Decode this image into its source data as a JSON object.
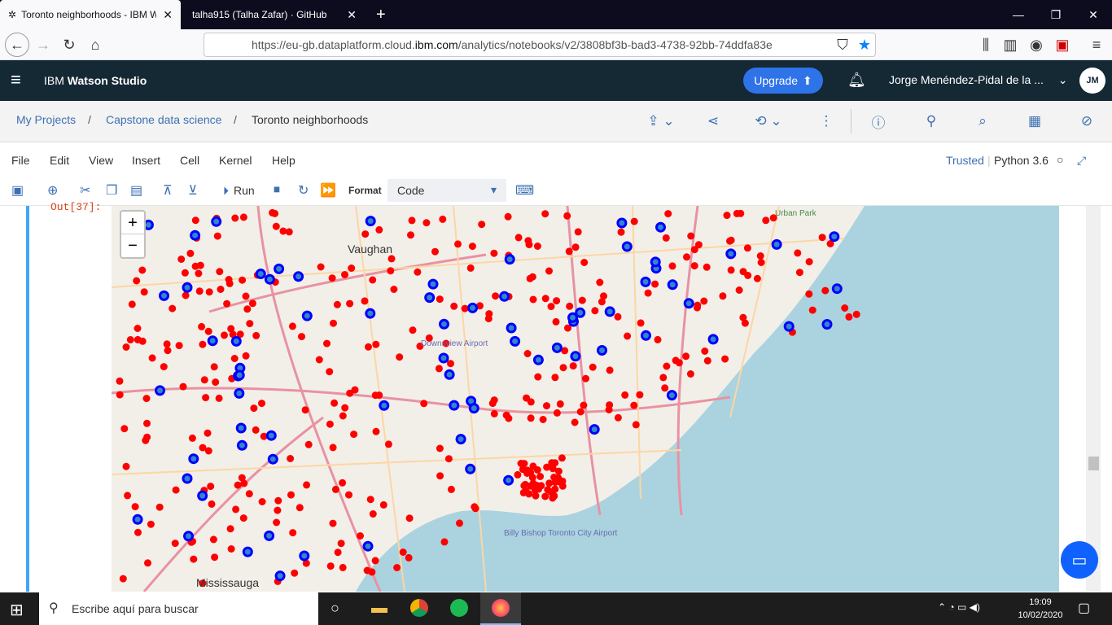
{
  "browser": {
    "tabs": [
      {
        "title": "Toronto neighborhoods - IBM W",
        "active": true
      },
      {
        "title": "talha915 (Talha Zafar) · GitHub",
        "active": false
      }
    ],
    "url_prefix": "https://eu-gb.dataplatform.cloud.",
    "url_domain": "ibm.com",
    "url_suffix": "/analytics/notebooks/v2/3808bf3b-bad3-4738-92bb-74ddfa83e"
  },
  "app": {
    "brand_prefix": "IBM ",
    "brand_name": "Watson Studio",
    "upgrade_label": "Upgrade",
    "user_name": "Jorge Menéndez-Pidal de la ...",
    "user_initials": "JM"
  },
  "breadcrumb": {
    "items": [
      "My Projects",
      "Capstone data science",
      "Toronto neighborhoods"
    ],
    "separator": "/"
  },
  "notebook": {
    "menu": [
      "File",
      "Edit",
      "View",
      "Insert",
      "Cell",
      "Kernel",
      "Help"
    ],
    "trusted_label": "Trusted",
    "kernel_label": "Python 3.6",
    "run_label": "Run",
    "format_label": "Format",
    "cell_type": "Code",
    "out_prompt": "Out[37]:"
  },
  "map": {
    "zoom_in": "+",
    "zoom_out": "−",
    "place_labels": [
      "Vaughan",
      "Mississauga",
      "Downsview Airport",
      "Billy Bishop Toronto City Airport",
      "Urban Park"
    ],
    "marker_colors": {
      "red": "#ff0000",
      "blue": "#0000ff"
    },
    "water_color": "#aad3df",
    "land_color": "#f2efe9"
  },
  "taskbar": {
    "search_placeholder": "Escribe aquí para buscar",
    "time": "19:09",
    "date": "10/02/2020"
  }
}
